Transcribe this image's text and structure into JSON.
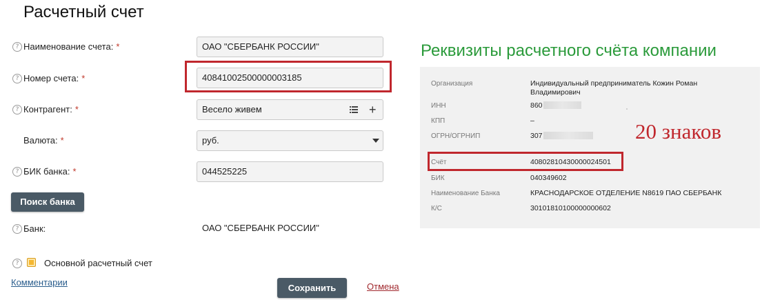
{
  "page_title": "Расчетный счет",
  "form": {
    "account_name": {
      "label": "Наименование счета:",
      "value": "ОАО \"СБЕРБАНК РОССИИ\""
    },
    "account_number": {
      "label": "Номер счета:",
      "value": "40841002500000003185"
    },
    "counterparty": {
      "label": "Контрагент:",
      "value": "Весело живем"
    },
    "currency": {
      "label": "Валюта:",
      "value": "руб."
    },
    "bik": {
      "label": "БИК банка:",
      "value": "044525225"
    },
    "required_mark": "*",
    "search_bank_button": "Поиск банка",
    "bank": {
      "label": "Банк:",
      "value": "ОАО \"СБЕРБАНК РОССИИ\""
    },
    "main_account_label": "Основной расчетный счет",
    "comments_link": "Комментарии",
    "save_button": "Сохранить",
    "cancel_link": "Отмена",
    "help_icon_glyph": "?"
  },
  "requisites": {
    "title": "Реквизиты расчетного счёта компании",
    "organization": {
      "label": "Организация",
      "value": "Индивидуальный предприниматель Кожин Роман Владимирович"
    },
    "inn": {
      "label": "ИНН",
      "value": "860"
    },
    "kpp": {
      "label": "КПП",
      "value": "–"
    },
    "ogrn": {
      "label": "ОГРН/ОГРНИП",
      "value": "307"
    },
    "account": {
      "label": "Счёт",
      "value": "40802810430000024501"
    },
    "bik": {
      "label": "БИК",
      "value": "040349602"
    },
    "bank_name": {
      "label": "Наименование Банка",
      "value": "КРАСНОДАРСКОЕ ОТДЕЛЕНИЕ N8619 ПАО СБЕРБАНК"
    },
    "ks": {
      "label": "К/С",
      "value": "30101810100000000602"
    }
  },
  "annotation": "20 знаков",
  "colors": {
    "highlight": "#c0272d",
    "panel_title": "#2a9a3a",
    "checkbox": "#f5b731"
  }
}
